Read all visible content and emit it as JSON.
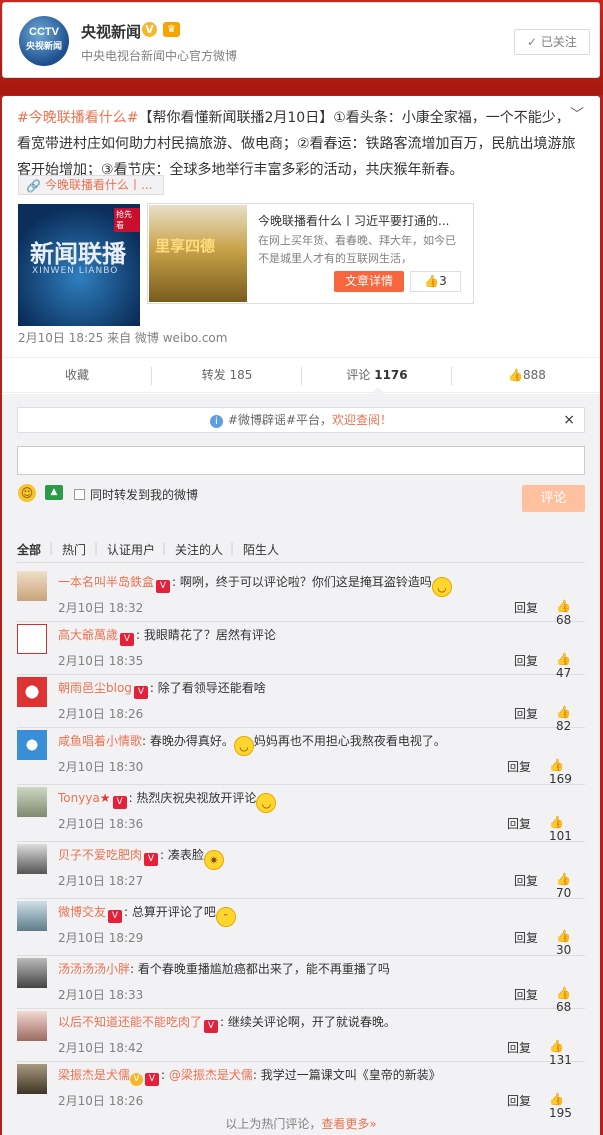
{
  "profile": {
    "logo_text": "CCTV",
    "logo_sub": "央视新闻",
    "name": "央视新闻",
    "desc": "中央电视台新闻中心官方微博",
    "follow_state": "已关注"
  },
  "post": {
    "topic": "#今晚联播看什么#",
    "text": "【帮你看懂新闻联播2月10日】①看头条：小康全家福，一个不能少，看宽带进村庄如何助力村民搞旅游、做电商；②看春运：铁路客流增加百万，民航出境游旅客开始增加；③看节庆：全球多地举行丰富多彩的活动，共庆猴年新春。",
    "link_chip": "今晚联播看什么丨...",
    "thumb": {
      "title": "新闻联播",
      "sub": "XINWEN LIANBO",
      "badge": "抢先看"
    },
    "article": {
      "img_text": "里享四德",
      "title": "今晚联播看什么丨习近平要打通的...",
      "summary": "在网上买年货、看春晚、拜大年，如今已不是城里人才有的互联网生活，",
      "button": "文章详情",
      "likes": "3"
    },
    "meta": "2月10日 18:25 来自 微博 weibo.com"
  },
  "actions": {
    "collect": "收藏",
    "repost_label": "转发",
    "repost_count": "185",
    "comment_label": "评论",
    "comment_count": "1176",
    "like_count": "888"
  },
  "comment_box": {
    "notice_pre": "#微博辟谣#平台，",
    "notice_link": "欢迎查阅！",
    "close": "×",
    "input_value": "",
    "also_repost": "同时转发到我的微博",
    "submit": "评论"
  },
  "tabs": [
    "全部",
    "热门",
    "认证用户",
    "关注的人",
    "陌生人"
  ],
  "comments": [
    {
      "user": "一本名叫半岛鉄盒",
      "text": "啊咧，终于可以评论啦？你们这是掩耳盗铃造吗",
      "time": "2月10日 18:32",
      "reply": "回复",
      "likes": "68"
    },
    {
      "user": "高大爺萬歲",
      "text": "我眼睛花了？居然有评论",
      "time": "2月10日 18:35",
      "reply": "回复",
      "likes": "47"
    },
    {
      "user": "朝雨邑尘blog",
      "text": "除了看领导还能看啥",
      "time": "2月10日 18:26",
      "reply": "回复",
      "likes": "82"
    },
    {
      "user": "咸鱼唱着小情歌",
      "text": "春晚办得真好。",
      "text2": "妈妈再也不用担心我熬夜看电视了。",
      "time": "2月10日 18:30",
      "reply": "回复",
      "likes": "169"
    },
    {
      "user": "Tonyya",
      "text": "热烈庆祝央视放开评论",
      "time": "2月10日 18:36",
      "reply": "回复",
      "likes": "101"
    },
    {
      "user": "贝子不爱吃肥肉",
      "text": "凑表脸",
      "time": "2月10日 18:27",
      "reply": "回复",
      "likes": "70"
    },
    {
      "user": "微博交友",
      "text": "总算开评论了吧",
      "time": "2月10日 18:29",
      "reply": "回复",
      "likes": "30"
    },
    {
      "user": "汤汤汤汤小胖",
      "text": "看个春晚重播尴尬癌都出来了，能不再重播了吗",
      "time": "2月10日 18:33",
      "reply": "回复",
      "likes": "68"
    },
    {
      "user": "以后不知道还能不能吃肉了",
      "text": "继续关评论啊，开了就说春晚。",
      "time": "2月10日 18:42",
      "reply": "回复",
      "likes": "131"
    },
    {
      "user": "梁振杰是犬儒",
      "mention": "@梁振杰是犬儒",
      "text": "我学过一篇课文叫《皇帝的新装》",
      "time": "2月10日 18:26",
      "reply": "回复",
      "likes": "195"
    }
  ],
  "more": {
    "pre": "以上为热门评论，",
    "link": "查看更多»"
  }
}
